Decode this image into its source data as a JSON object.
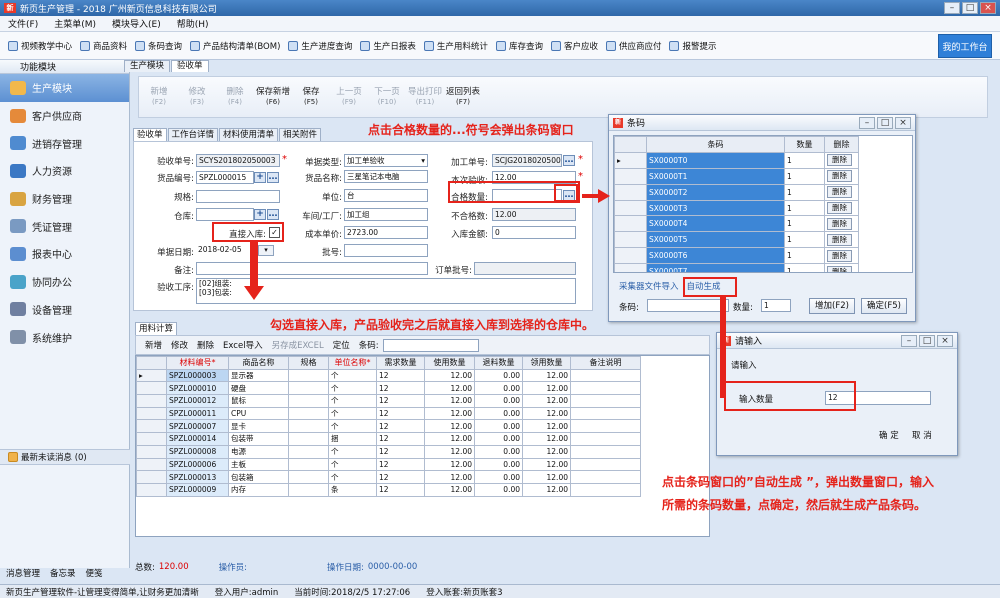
{
  "window": {
    "title": "新页生产管理 - 2018 广州新页信息科技有限公司",
    "logo_text": "新"
  },
  "menu": [
    "文件(F)",
    "主菜单(M)",
    "模块导入(E)",
    "帮助(H)"
  ],
  "quickbar": [
    "视频教学中心",
    "商品资料",
    "条码查询",
    "产品结构清单(BOM)",
    "生产进度查询",
    "生产日报表",
    "生产用料统计",
    "库存查询",
    "客户应收",
    "供应商应付",
    "报警提示"
  ],
  "workspace_btn": "我的工作台",
  "sidebar": {
    "header": "功能模块",
    "items": [
      "生产模块",
      "客户供应商",
      "进销存管理",
      "人力资源",
      "财务管理",
      "凭证管理",
      "报表中心",
      "协同办公",
      "设备管理",
      "系统维护"
    ],
    "active": 0,
    "news": "最新未读消息 (0)",
    "footer": [
      "消息管理",
      "备忘录",
      "便笺"
    ]
  },
  "top_tabs": [
    "生产模块",
    "验收单"
  ],
  "toolbar": [
    {
      "label": "新增",
      "key": "(F2)",
      "dis": true
    },
    {
      "label": "修改",
      "key": "(F3)",
      "dis": true
    },
    {
      "label": "删除",
      "key": "(F4)",
      "dis": true
    },
    {
      "label": "保存新增",
      "key": "(F6)",
      "dis": false
    },
    {
      "label": "保存",
      "key": "(F5)",
      "dis": false
    },
    {
      "label": "上一页",
      "key": "(F9)",
      "dis": true
    },
    {
      "label": "下一页",
      "key": "(F10)",
      "dis": true
    },
    {
      "label": "导出打印",
      "key": "(F11)",
      "dis": true
    },
    {
      "label": "返回列表",
      "key": "(F7)",
      "dis": false
    }
  ],
  "form_tabs": [
    "验收单",
    "工作台详情",
    "材料使用清单",
    "相关附件"
  ],
  "form": {
    "l_accept_no": "验收单号:",
    "accept_no": "SCYS201802050003",
    "l_goods_no": "货品编号:",
    "goods_no": "SPZL000015",
    "l_spec": "规格:",
    "l_warehouse": "仓库:",
    "l_direct": "直接入库:",
    "l_date": "单据日期:",
    "date": "2018-02-05",
    "l_remark": "备注:",
    "l_process": "验收工序:",
    "process": "[02]组装:\n[03]包装:",
    "l_doc_type": "单据类型:",
    "doc_type": "加工单验收",
    "l_goods_name": "货品名称:",
    "goods_name": "三星笔记本电脑",
    "l_unit": "单位:",
    "unit": "台",
    "l_workshop": "车间/工厂:",
    "workshop": "加工组",
    "l_cost": "成本单价:",
    "cost": "2723.00",
    "l_batch": "批号:",
    "l_order_batch": "订单批号:",
    "l_process_no": "加工单号:",
    "process_no": "SCJG201802050003",
    "l_this_accept": "本次验收:",
    "this_accept": "12.00",
    "l_qualified": "合格数量:",
    "l_unqualified": "不合格数:",
    "unqualified": "12.00",
    "l_amount": "入库金额:",
    "amount": "0"
  },
  "grid_tab": "用料计算",
  "grid_toolbar": [
    "新增",
    "修改",
    "删除",
    "Excel导入",
    "另存成EXCEL",
    "定位",
    "条码:"
  ],
  "grid": {
    "headers": [
      "材料编号*",
      "商品名称",
      "规格",
      "单位名称*",
      "需求数量",
      "使用数量",
      "退料数量",
      "领用数量",
      "备注说明"
    ],
    "rows": [
      [
        "SPZL000003",
        "显示器",
        "",
        "个",
        "12",
        "12.00",
        "0.00",
        "12.00",
        ""
      ],
      [
        "SPZL000010",
        "硬盘",
        "",
        "个",
        "12",
        "12.00",
        "0.00",
        "12.00",
        ""
      ],
      [
        "SPZL000012",
        "鼠标",
        "",
        "个",
        "12",
        "12.00",
        "0.00",
        "12.00",
        ""
      ],
      [
        "SPZL000011",
        "CPU",
        "",
        "个",
        "12",
        "12.00",
        "0.00",
        "12.00",
        ""
      ],
      [
        "SPZL000007",
        "显卡",
        "",
        "个",
        "12",
        "12.00",
        "0.00",
        "12.00",
        ""
      ],
      [
        "SPZL000014",
        "包装带",
        "",
        "捆",
        "12",
        "12.00",
        "0.00",
        "12.00",
        ""
      ],
      [
        "SPZL000008",
        "电源",
        "",
        "个",
        "12",
        "12.00",
        "0.00",
        "12.00",
        ""
      ],
      [
        "SPZL000006",
        "主板",
        "",
        "个",
        "12",
        "12.00",
        "0.00",
        "12.00",
        ""
      ],
      [
        "SPZL000013",
        "包装箱",
        "",
        "个",
        "12",
        "12.00",
        "0.00",
        "12.00",
        ""
      ],
      [
        "SPZL000009",
        "内存",
        "",
        "条",
        "12",
        "12.00",
        "0.00",
        "12.00",
        ""
      ]
    ]
  },
  "summary": {
    "total_label": "总数:",
    "total": "120.00",
    "operator": "操作员:",
    "op_date_label": "操作日期:",
    "op_date": "0000-00-00"
  },
  "status": [
    "新页生产管理软件-让管理变得简单,让财务更加清晰",
    "登入用户:admin",
    "当前时间:2018/2/5 17:27:06",
    "登入账套:新页账套3"
  ],
  "barcode_dialog": {
    "title": "条码",
    "headers": [
      "条码",
      "数量",
      "删除"
    ],
    "rows": [
      [
        "SX0000T0",
        "1",
        "删除"
      ],
      [
        "SX0000T1",
        "1",
        "删除"
      ],
      [
        "SX0000T2",
        "1",
        "删除"
      ],
      [
        "SX0000T3",
        "1",
        "删除"
      ],
      [
        "SX0000T4",
        "1",
        "删除"
      ],
      [
        "SX0000T5",
        "1",
        "删除"
      ],
      [
        "SX0000T6",
        "1",
        "删除"
      ],
      [
        "SX0000T7",
        "1",
        "删除"
      ]
    ],
    "tab_import": "采集器文件导入",
    "tab_auto": "自动生成",
    "l_code": "条码:",
    "l_qty": "数量:",
    "qty": "1",
    "btn_add": "增加(F2)",
    "btn_ok": "确定(F5)"
  },
  "input_dialog": {
    "title": "请输入",
    "sub": "请输入",
    "label": "输入数量",
    "value": "12",
    "ok": "确 定",
    "cancel": "取 消"
  },
  "annotations": {
    "a1": "点击合格数量的...符号会弹出条码窗口",
    "a2": "勾选直接入库，产品验收完之后就直接入库到选择的仓库中。",
    "a3": "点击条码窗口的”自动生成 ”，弹出数量窗口，输入",
    "a4": "所需的条码数量，点确定，然后就生成产品条码。"
  }
}
